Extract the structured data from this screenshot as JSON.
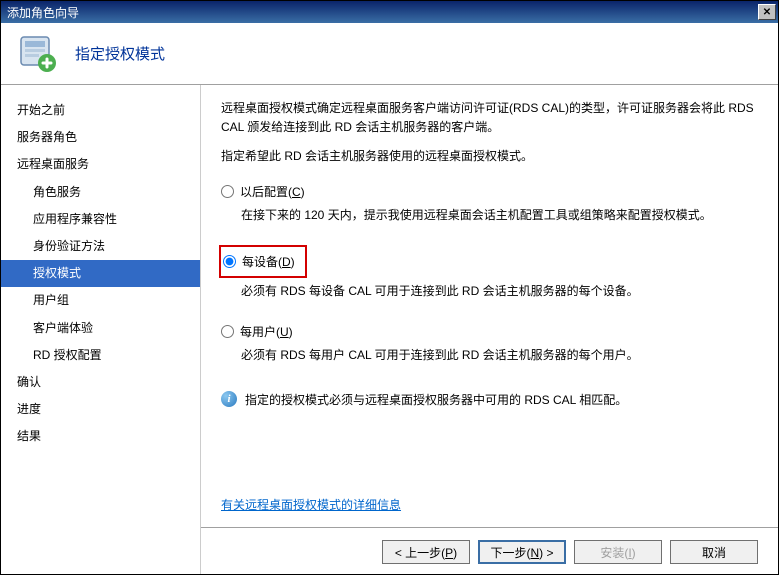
{
  "titlebar": {
    "title": "添加角色向导"
  },
  "header": {
    "title": "指定授权模式"
  },
  "sidebar": {
    "items": [
      {
        "label": "开始之前",
        "sub": false
      },
      {
        "label": "服务器角色",
        "sub": false
      },
      {
        "label": "远程桌面服务",
        "sub": false
      },
      {
        "label": "角色服务",
        "sub": true
      },
      {
        "label": "应用程序兼容性",
        "sub": true
      },
      {
        "label": "身份验证方法",
        "sub": true
      },
      {
        "label": "授权模式",
        "sub": true,
        "selected": true
      },
      {
        "label": "用户组",
        "sub": true
      },
      {
        "label": "客户端体验",
        "sub": true
      },
      {
        "label": "RD 授权配置",
        "sub": true
      },
      {
        "label": "确认",
        "sub": false
      },
      {
        "label": "进度",
        "sub": false
      },
      {
        "label": "结果",
        "sub": false
      }
    ]
  },
  "content": {
    "intro": "远程桌面授权模式确定远程桌面服务客户端访问许可证(RDS CAL)的类型，许可证服务器会将此 RDS CAL 颁发给连接到此 RD 会话主机服务器的客户端。",
    "prompt": "指定希望此 RD 会话主机服务器使用的远程桌面授权模式。",
    "options": {
      "later": {
        "label": "以后配置(C)",
        "desc": "在接下来的 120 天内，提示我使用远程桌面会话主机配置工具或组策略来配置授权模式。"
      },
      "device": {
        "label": "每设备(D)",
        "desc": "必须有 RDS 每设备 CAL 可用于连接到此 RD 会话主机服务器的每个设备。"
      },
      "user": {
        "label": "每用户(U)",
        "desc": "必须有 RDS 每用户 CAL 可用于连接到此 RD 会话主机服务器的每个用户。"
      }
    },
    "info": "指定的授权模式必须与远程桌面授权服务器中可用的 RDS CAL 相匹配。",
    "link": "有关远程桌面授权模式的详细信息"
  },
  "buttons": {
    "prev": "< 上一步(P)",
    "next": "下一步(N) >",
    "install": "安装(I)",
    "cancel": "取消"
  }
}
